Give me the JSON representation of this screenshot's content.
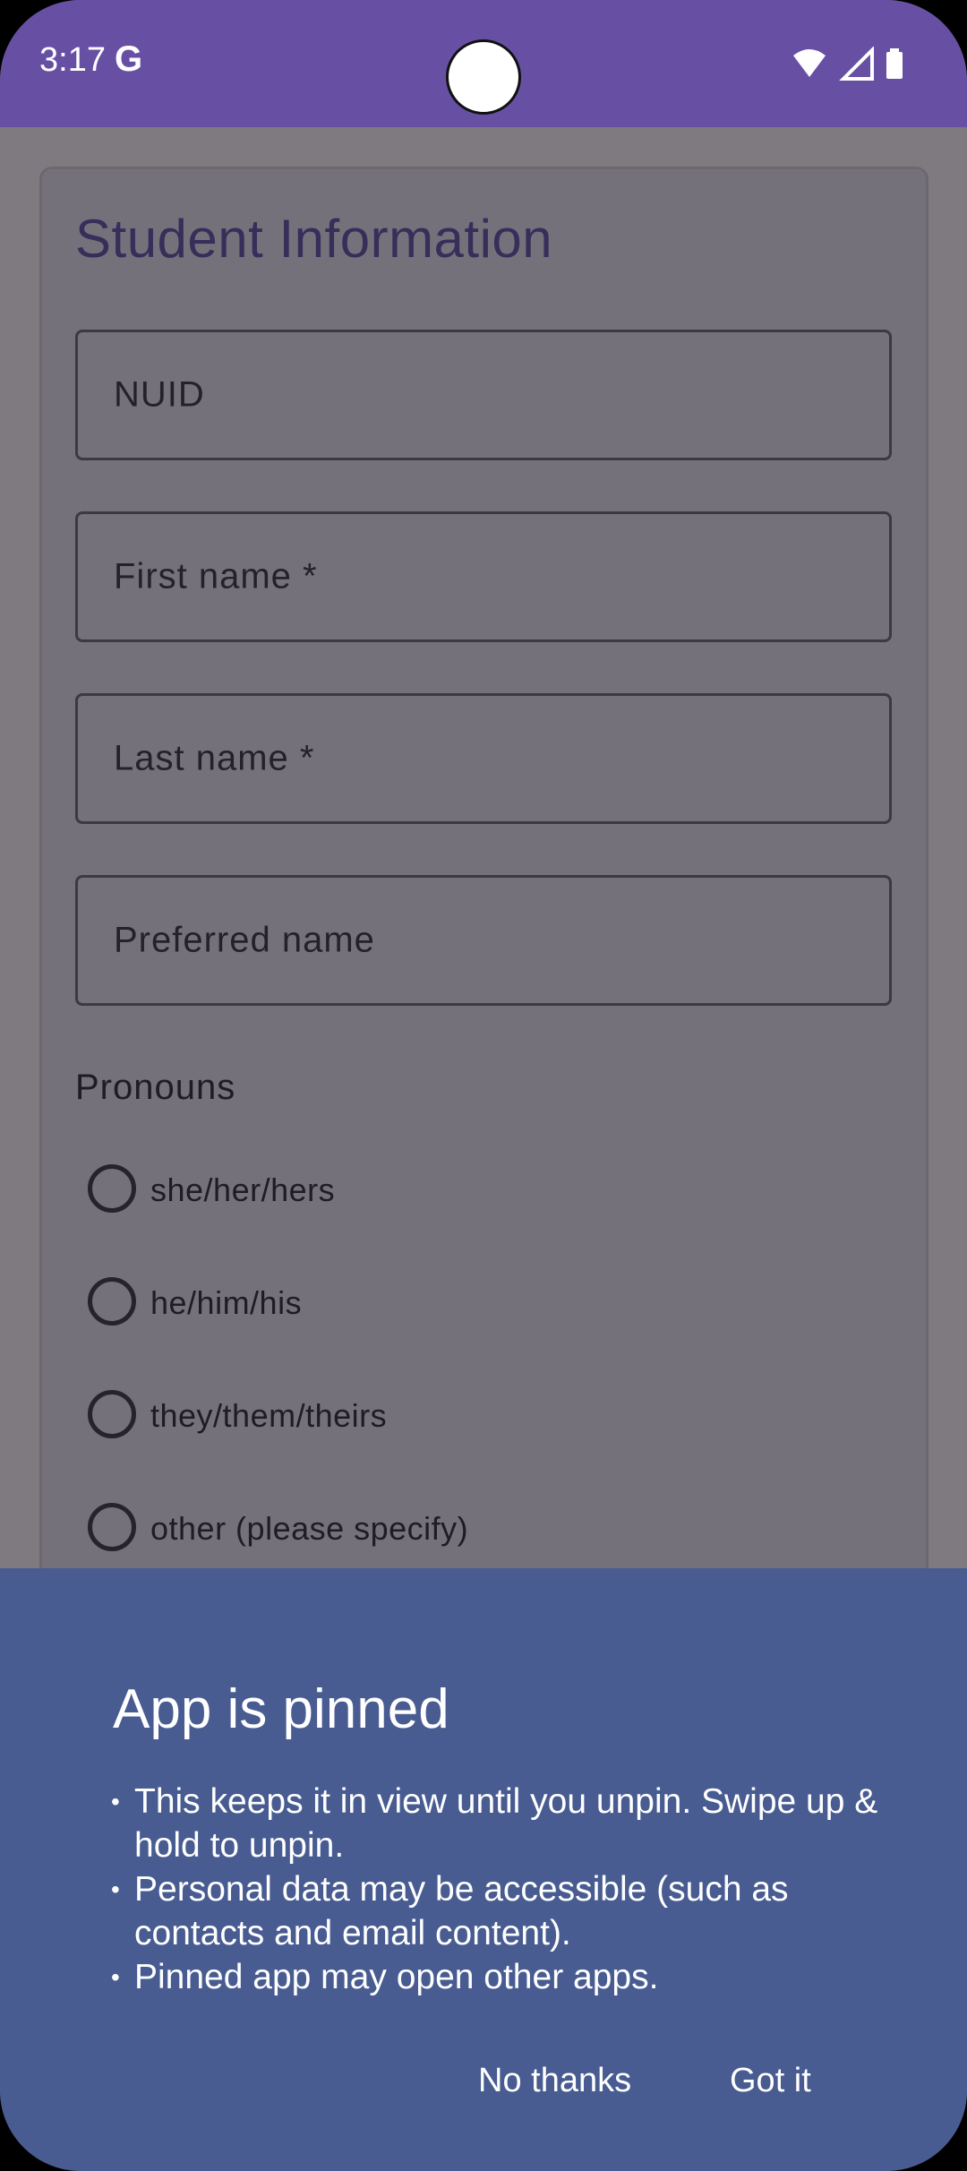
{
  "status_bar": {
    "time": "3:17",
    "g_logo": "G",
    "icons": [
      "wifi-icon",
      "cell-signal-icon",
      "battery-icon"
    ],
    "color": "#6750a4"
  },
  "form": {
    "title": "Student Information",
    "fields": {
      "nuid": "NUID",
      "first_name": "First name *",
      "last_name": "Last name *",
      "preferred_name": "Preferred name"
    },
    "pronouns_label": "Pronouns",
    "pronoun_options": [
      "she/her/hers",
      "he/him/his",
      "they/them/theirs",
      "other (please specify)"
    ]
  },
  "pin_dialog": {
    "title": "App is pinned",
    "bullets": [
      "This keeps it in view until you unpin. Swipe up & hold to unpin.",
      "Personal data may be accessible (such as contacts and email content).",
      "Pinned app may open other apps."
    ],
    "no_thanks": "No thanks",
    "got_it": "Got it",
    "color": "#485c91"
  }
}
